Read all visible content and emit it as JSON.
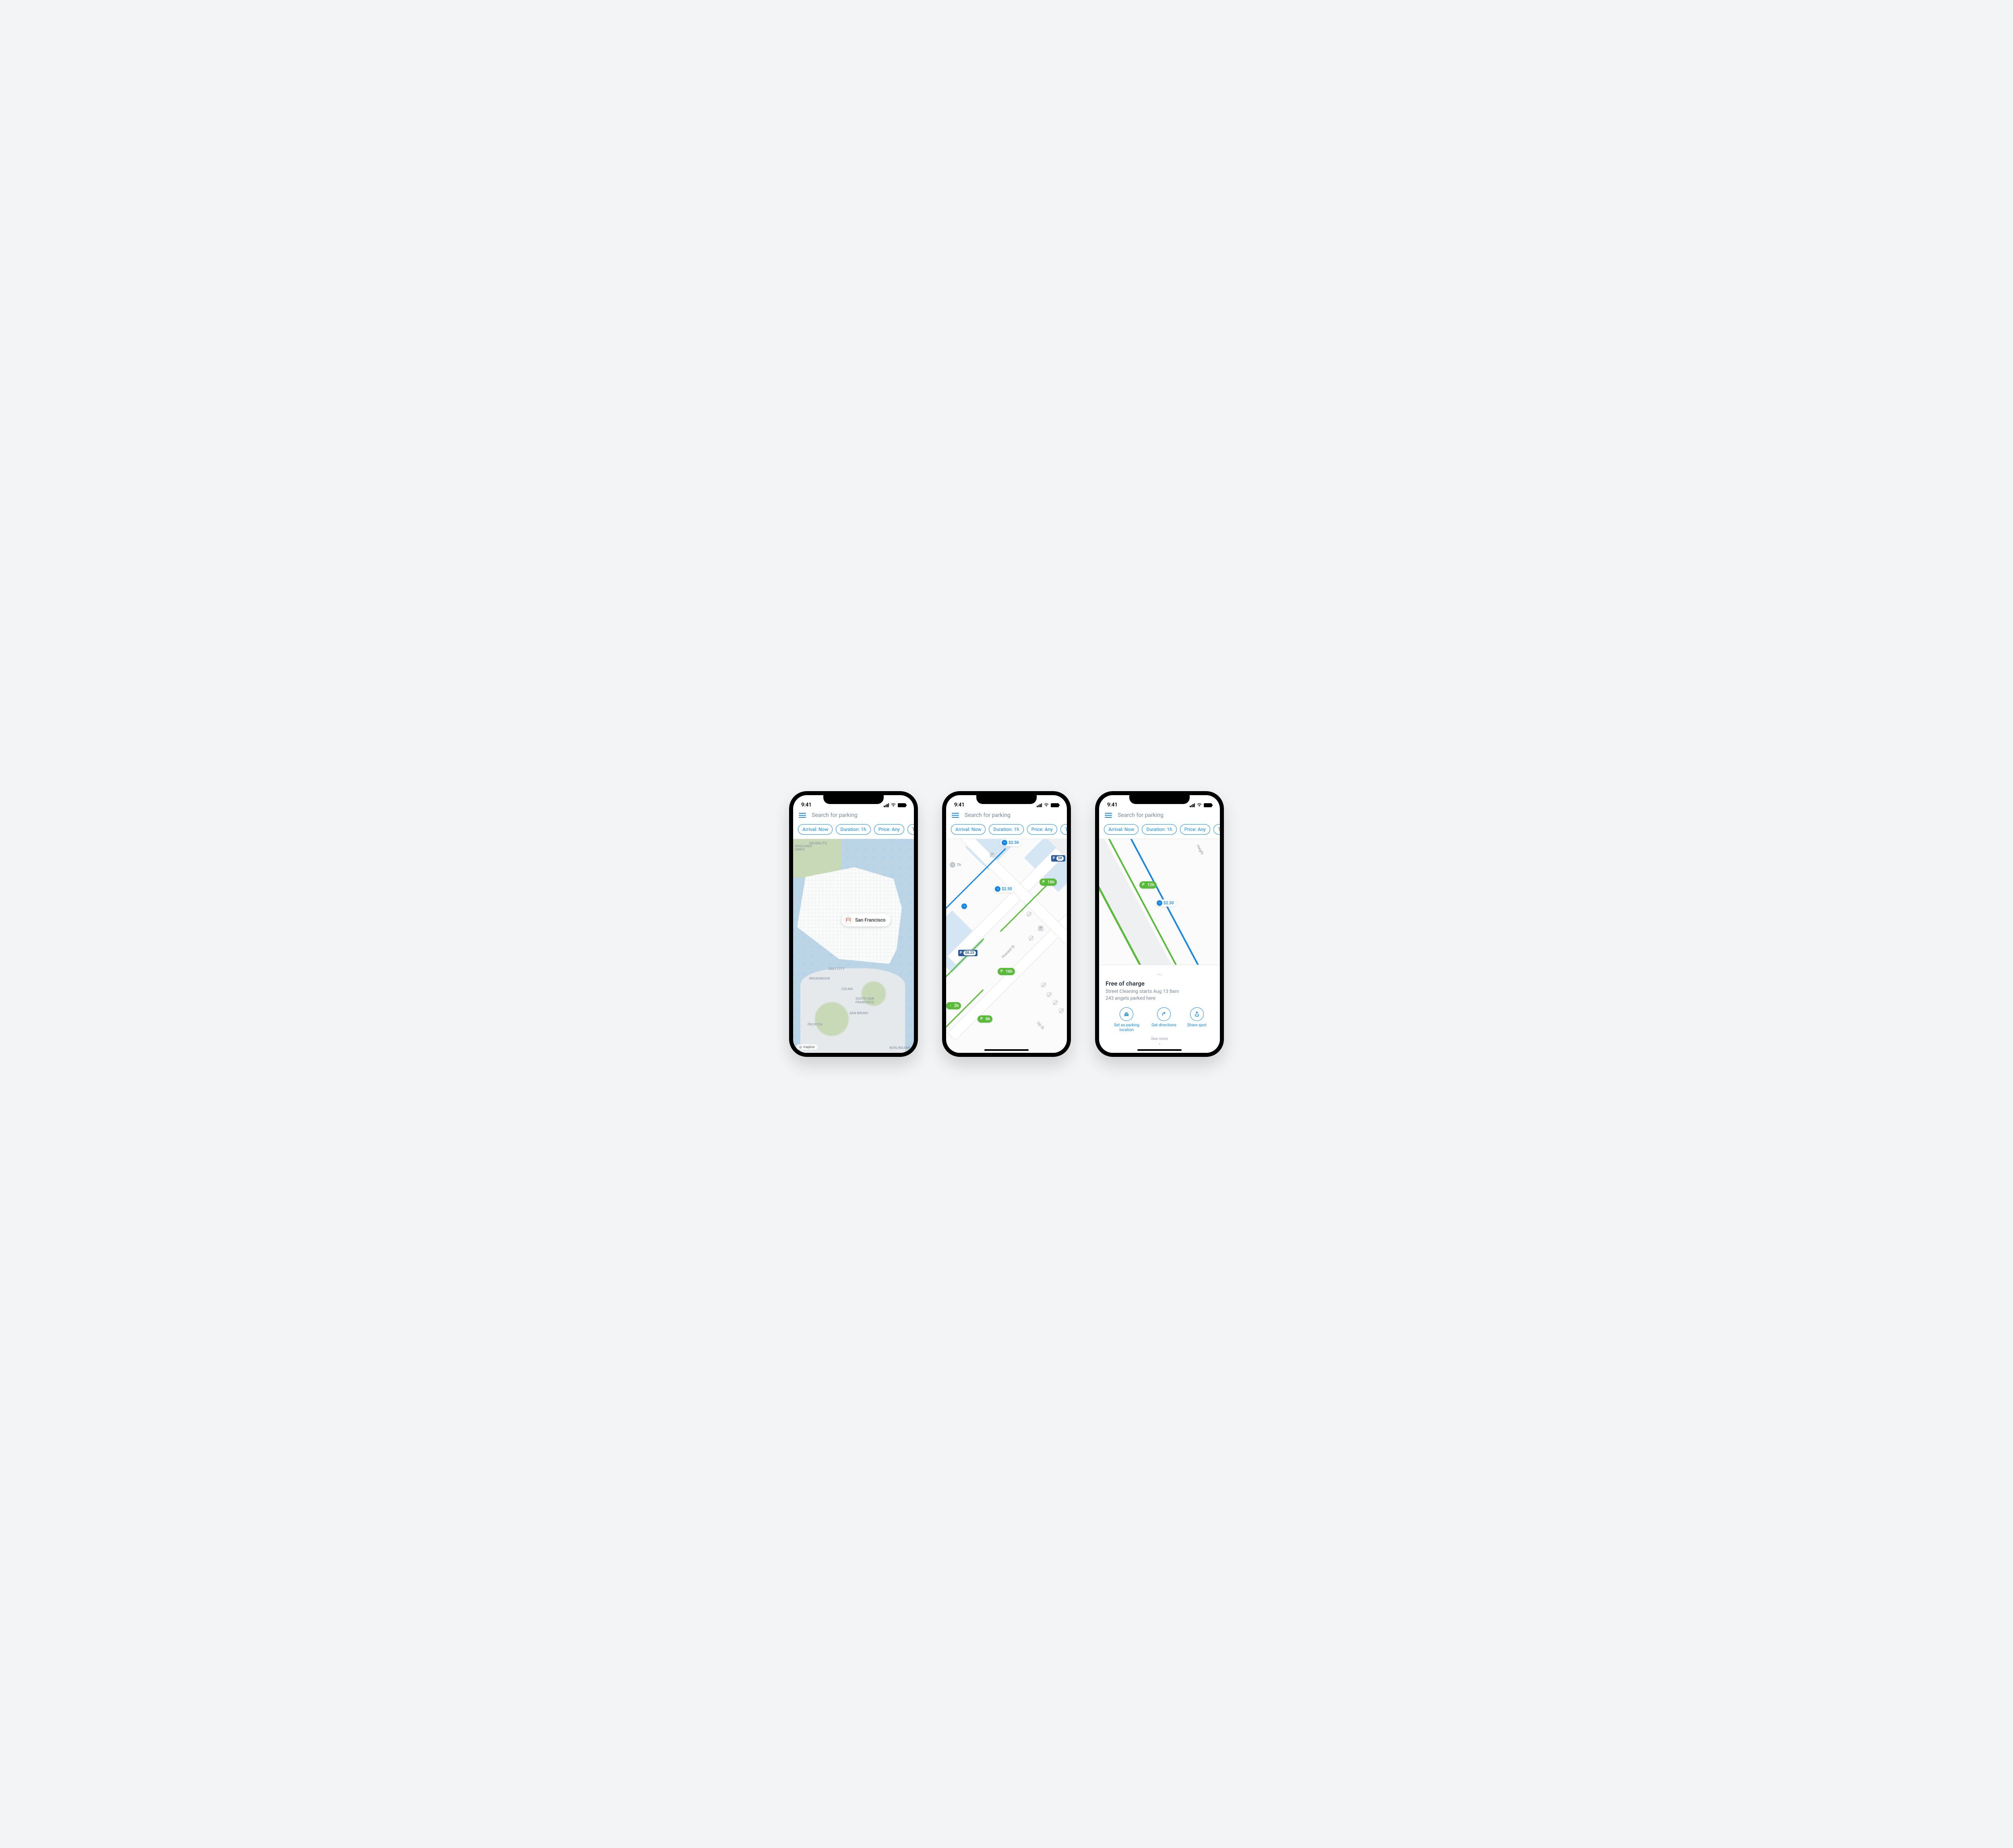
{
  "status": {
    "time": "9:41"
  },
  "search": {
    "placeholder": "Search for parking"
  },
  "filters": {
    "arrival": "Arrival: Now",
    "duration": "Duration: 1h",
    "price": "Price: Any",
    "type": "Typ"
  },
  "screen1": {
    "city_badge": "San Francisco",
    "labels": {
      "sausalito": "SAUSALITO",
      "headlands": "Headlands\n(GNRA)",
      "daly": "DALY CITY",
      "broadmoor": "BROADMOOR",
      "colma": "COLMA",
      "ssf": "SOUTH SAN\nFRANCISCO",
      "sanbruno": "SAN BRUNO",
      "pacifica": "PACIFICA",
      "burlingame": "BURLINGAME"
    },
    "attribution": "mapbox"
  },
  "screen2": {
    "markers": {
      "m1_price": "$2.50",
      "m2_time": "1h",
      "m3_price": "$2.50",
      "m4_time": "16h",
      "m5_lot_price": "$8.25",
      "m6_lot_price2": "$8",
      "m7_time": "16h",
      "m8_time": "2h",
      "m9_time": "6h"
    },
    "streets": {
      "howard": "Howard St",
      "seventh": "7th St"
    }
  },
  "screen3": {
    "markers": {
      "p_time": "12h",
      "m_price": "$2.50"
    },
    "street": "Haight",
    "sheet": {
      "title": "Free of charge",
      "line1": "Street Cleaning starts Aug 13 8am",
      "line2": "243 angels parked here",
      "actions": {
        "set": "Set as parking location",
        "directions": "Get directions",
        "share": "Share spot"
      },
      "see_more": "See more"
    }
  }
}
